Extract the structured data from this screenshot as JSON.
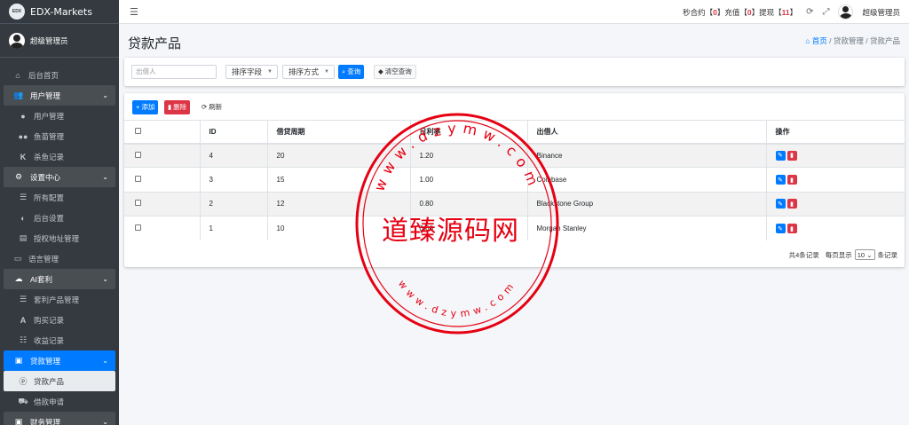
{
  "brand": {
    "logo_text": "EDX",
    "name": "EDX-Markets"
  },
  "user": {
    "name": "超级管理员"
  },
  "sidebar": {
    "items": [
      {
        "label": "后台首页",
        "icon": "home-icon",
        "type": "item"
      },
      {
        "label": "用户管理",
        "icon": "users-icon",
        "type": "group"
      },
      {
        "label": "用户管理",
        "icon": "user-icon",
        "type": "sub"
      },
      {
        "label": "鱼苗管理",
        "icon": "users-icon",
        "type": "sub"
      },
      {
        "label": "杀鱼记录",
        "icon": "k-icon",
        "type": "sub"
      },
      {
        "label": "设置中心",
        "icon": "gears-icon",
        "type": "group"
      },
      {
        "label": "所有配置",
        "icon": "list-icon",
        "type": "sub"
      },
      {
        "label": "后台设置",
        "icon": "half-circle-icon",
        "type": "sub"
      },
      {
        "label": "授权地址管理",
        "icon": "doc-icon",
        "type": "sub"
      },
      {
        "label": "语言管理",
        "icon": "id-card-icon",
        "type": "item"
      },
      {
        "label": "AI套利",
        "icon": "android-icon",
        "type": "group"
      },
      {
        "label": "套利产品管理",
        "icon": "list-icon",
        "type": "sub"
      },
      {
        "label": "购买记录",
        "icon": "a-box-icon",
        "type": "sub"
      },
      {
        "label": "收益记录",
        "icon": "list-ol-icon",
        "type": "sub"
      },
      {
        "label": "贷款管理",
        "icon": "money-icon",
        "type": "group-active"
      },
      {
        "label": "贷款产品",
        "icon": "p-circle-icon",
        "type": "sub-current"
      },
      {
        "label": "借款申请",
        "icon": "truck-icon",
        "type": "sub"
      },
      {
        "label": "财务管理",
        "icon": "money-icon",
        "type": "group"
      }
    ]
  },
  "topbar": {
    "stats_prefix1": "秒合约【",
    "stats_v1": "0",
    "stats_mid1": "】充值【",
    "stats_v2": "0",
    "stats_mid2": "】提现【",
    "stats_v3": "11",
    "stats_suffix": "】",
    "user": "超级管理员"
  },
  "page": {
    "title": "贷款产品",
    "breadcrumb": [
      "首页",
      "贷款管理",
      "贷款产品"
    ]
  },
  "filter": {
    "placeholder": "出借人",
    "sort_field": "排序字段",
    "sort_order": "排序方式",
    "search": "查询",
    "clear": "清空查询"
  },
  "toolbar": {
    "add": "添加",
    "delete": "删除",
    "refresh": "刷新"
  },
  "table": {
    "headers": [
      "ID",
      "借贷周期",
      "日利率",
      "出借人",
      "操作"
    ],
    "rows": [
      {
        "id": "4",
        "period": "20",
        "rate": "1.20",
        "lender": "Binance"
      },
      {
        "id": "3",
        "period": "15",
        "rate": "1.00",
        "lender": "Coinbase"
      },
      {
        "id": "2",
        "period": "12",
        "rate": "0.80",
        "lender": "Blackstone Group"
      },
      {
        "id": "1",
        "period": "10",
        "rate": "0.60",
        "lender": "Morgan Stanley"
      }
    ]
  },
  "pager": {
    "total": "共4条记录",
    "per_page_prefix": "每页显示",
    "per_page": "10",
    "per_page_suffix": "条记录"
  },
  "watermark": {
    "main": "道臻源码网",
    "ring_top": "www.dzymw.com",
    "ring_bottom": "www.dzymw.com"
  },
  "colors": {
    "primary": "#007bff",
    "danger": "#dc3545",
    "sidebar": "#343a40",
    "watermark": "#e60012"
  }
}
